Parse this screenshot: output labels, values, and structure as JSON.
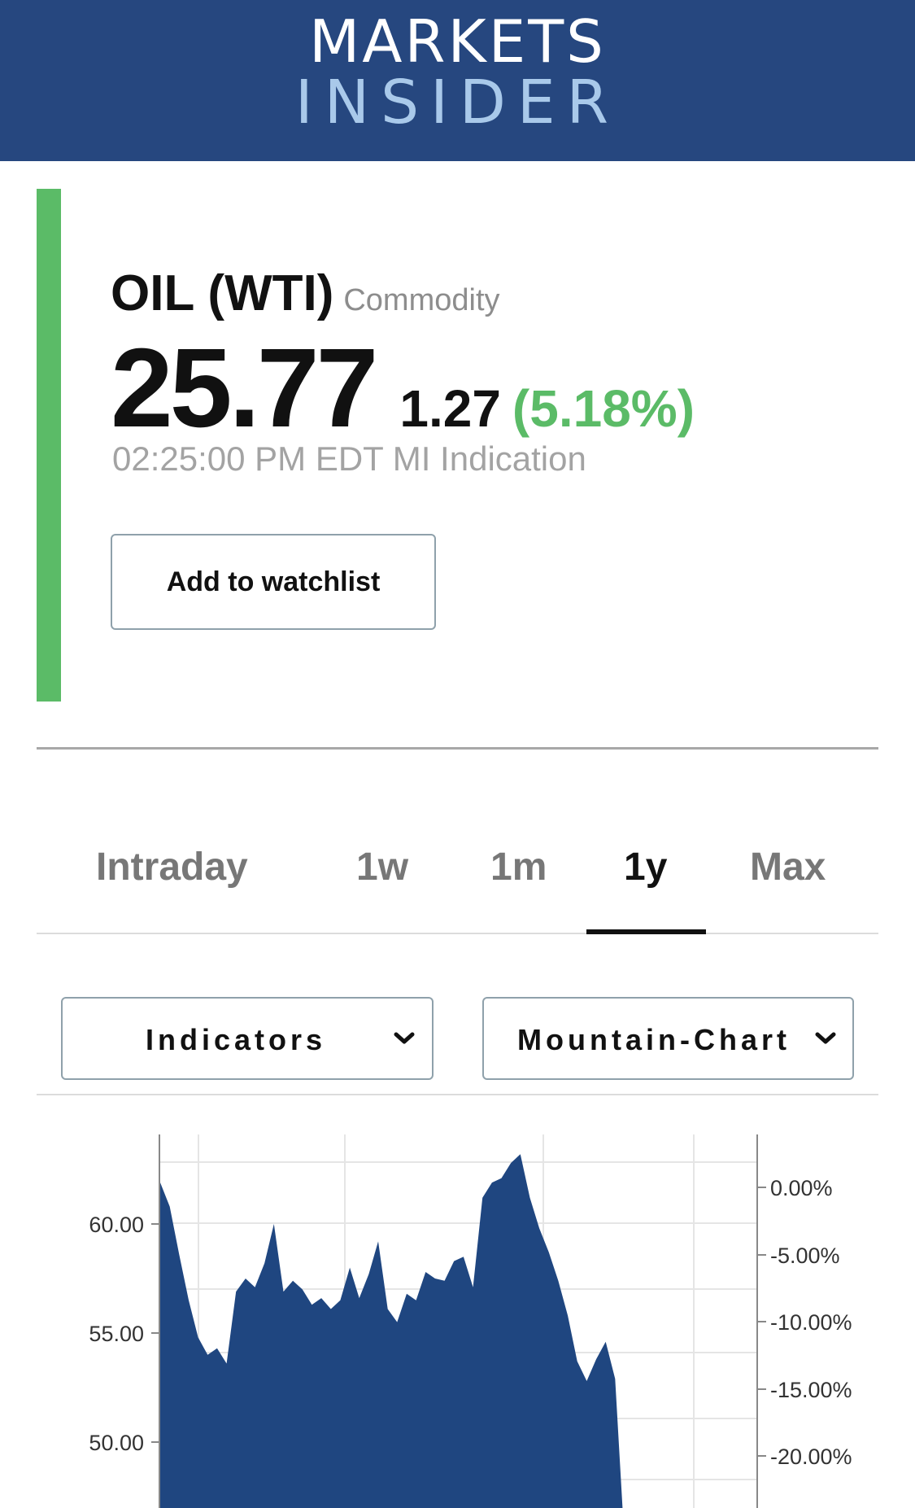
{
  "header": {
    "logo_line1": "MARKETS",
    "logo_line2": "INSIDER",
    "background": "#26477f"
  },
  "instrument": {
    "name": "OIL (WTI)",
    "type": "Commodity",
    "price": "25.77",
    "change": "1.27",
    "change_pct": "(5.18%)",
    "timestamp": "02:25:00 PM EDT MI Indication",
    "status_color": "#5bbb67"
  },
  "actions": {
    "watchlist_label": "Add to watchlist"
  },
  "tabs": [
    {
      "label": "Intraday",
      "active": false
    },
    {
      "label": "1w",
      "active": false
    },
    {
      "label": "1m",
      "active": false
    },
    {
      "label": "1y",
      "active": true
    },
    {
      "label": "Max",
      "active": false
    }
  ],
  "controls": {
    "indicators_label": "Indicators",
    "chart_type_label": "Mountain-Chart"
  },
  "chart_data": {
    "type": "area",
    "fill_color": "#1f4680",
    "ylabel_left_ticks": [
      "60.00",
      "55.00",
      "50.00"
    ],
    "ylabel_right_ticks": [
      "0.00%",
      "-5.00%",
      "-10.00%",
      "-15.00%",
      "-20.00%"
    ],
    "ylim": [
      45.3,
      63.3
    ],
    "values": [
      61.9,
      60.8,
      58.6,
      56.5,
      54.8,
      54.0,
      54.3,
      53.6,
      56.9,
      57.5,
      57.1,
      58.2,
      60.0,
      56.9,
      57.4,
      57.0,
      56.3,
      56.6,
      56.1,
      56.5,
      58.0,
      56.6,
      57.7,
      59.2,
      56.1,
      55.5,
      56.8,
      56.5,
      57.8,
      57.5,
      57.4,
      58.3,
      58.5,
      57.1,
      61.2,
      61.9,
      62.1,
      62.8,
      63.2,
      61.2,
      59.8,
      58.7,
      57.4,
      55.8,
      53.7,
      52.8,
      53.8,
      54.6,
      52.9,
      45.3
    ],
    "grid": true
  }
}
